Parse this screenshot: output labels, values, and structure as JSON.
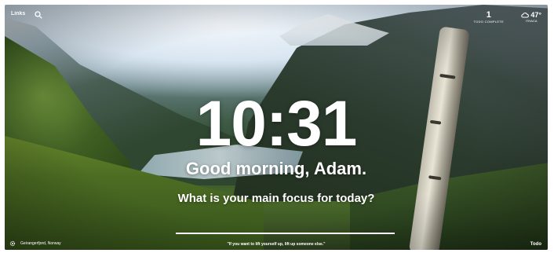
{
  "top_left": {
    "links_label": "Links"
  },
  "top_right": {
    "todo_count": "1",
    "todo_label": "TODO COMPLETE",
    "temperature": "47°",
    "location_label": "ITHACA"
  },
  "clock": {
    "time": "10:31"
  },
  "greeting": {
    "text": "Good morning, Adam."
  },
  "focus": {
    "question": "What is your main focus for today?",
    "value": "",
    "placeholder": ""
  },
  "bottom": {
    "location": "Geirangerfjord, Norway",
    "quote": "\"If you want to lift yourself up, lift up someone else.\"",
    "todo_label": "Todo"
  },
  "icons": {
    "search": "search-icon",
    "weather": "cloud-icon",
    "settings": "gear-icon"
  },
  "colors": {
    "text": "#ffffff",
    "underline": "#ffffff"
  }
}
